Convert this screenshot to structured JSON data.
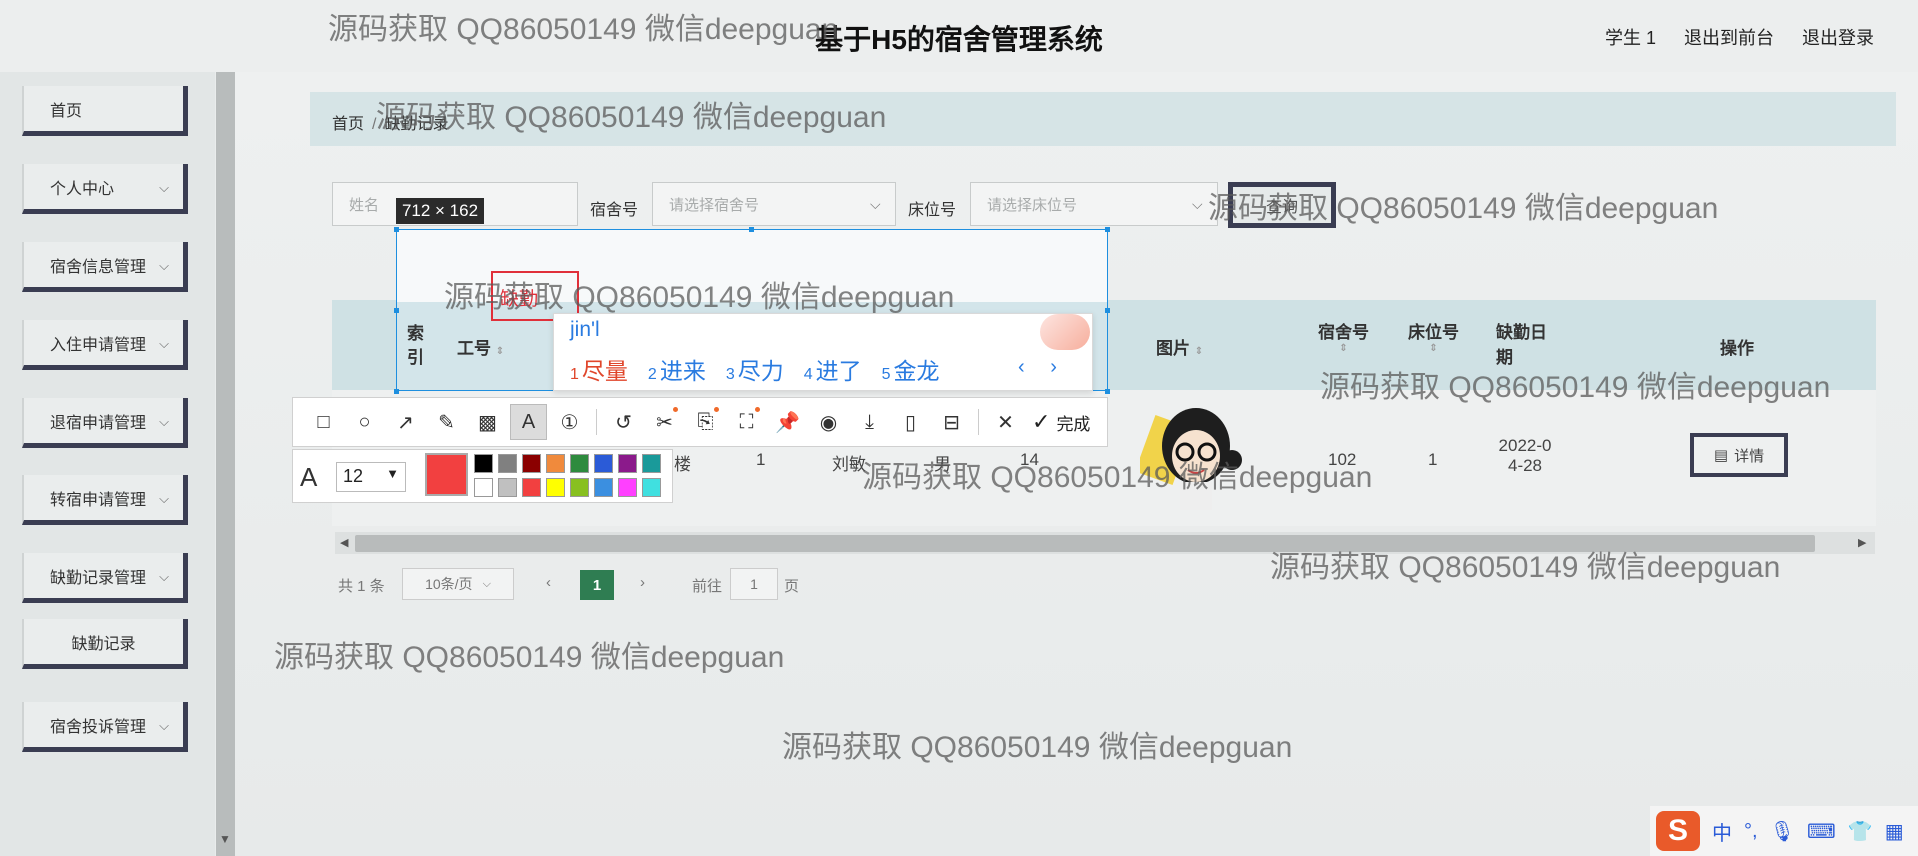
{
  "header": {
    "title": "基于H5的宿舍管理系统",
    "links": [
      "学生 1",
      "退出到前台",
      "退出登录"
    ]
  },
  "sidebar": {
    "items": [
      {
        "label": "首页",
        "chevron": false
      },
      {
        "label": "个人中心",
        "chevron": true
      },
      {
        "label": "宿舍信息管理",
        "chevron": true
      },
      {
        "label": "入住申请管理",
        "chevron": true
      },
      {
        "label": "退宿申请管理",
        "chevron": true
      },
      {
        "label": "转宿申请管理",
        "chevron": true
      },
      {
        "label": "缺勤记录管理",
        "chevron": true
      },
      {
        "label": "缺勤记录",
        "chevron": false
      },
      {
        "label": "宿舍投诉管理",
        "chevron": true
      }
    ]
  },
  "breadcrumb": {
    "home": "首页",
    "sep": "/",
    "current": "缺勤记录"
  },
  "filters": {
    "name_placeholder": "姓名",
    "dorm_label": "宿舍号",
    "dorm_placeholder": "请选择宿舍号",
    "bed_label": "床位号",
    "bed_placeholder": "请选择床位号",
    "search_label": "查询"
  },
  "table": {
    "headers": [
      "索引",
      "工号",
      "图片",
      "宿舍号",
      "床位号",
      "缺勤日期",
      "操作"
    ],
    "row": {
      "c1": "楼",
      "c2": "1",
      "c3": "刘敏",
      "c4": "男",
      "c5": "14",
      "dorm": "102",
      "bed": "1",
      "date_line1": "2022-0",
      "date_line2": "4-28",
      "detail_label": "详情"
    }
  },
  "pagination": {
    "total": "共 1 条",
    "page_size": "10条/页",
    "current_page": "1",
    "goto_label": "前往",
    "goto_value": "1",
    "goto_suffix": "页"
  },
  "capture": {
    "size_label": "712 × 162",
    "annotation_text": "缺勤"
  },
  "ime": {
    "input": "jin'l",
    "candidates": [
      {
        "n": "1",
        "text": "尽量"
      },
      {
        "n": "2",
        "text": "进来"
      },
      {
        "n": "3",
        "text": "尽力"
      },
      {
        "n": "4",
        "text": "进了"
      },
      {
        "n": "5",
        "text": "金龙"
      }
    ],
    "nav": "‹ ›"
  },
  "toolbar": {
    "done_label": "完成",
    "font_size": "12",
    "current_color": "#f24040",
    "palette": [
      "#000000",
      "#808080",
      "#8b0000",
      "#f08a3c",
      "#2e8b3e",
      "#2b5bd7",
      "#8b1a8b",
      "#1a9a9a",
      "#ffffff",
      "#c0c0c0",
      "#f24040",
      "#ffff00",
      "#88c020",
      "#3b8fe0",
      "#ff40ff",
      "#40e0e0"
    ]
  },
  "watermark": "源码获取 QQ86050149 微信deepguan",
  "tray": {
    "lang": "中",
    "punct": "°,"
  }
}
